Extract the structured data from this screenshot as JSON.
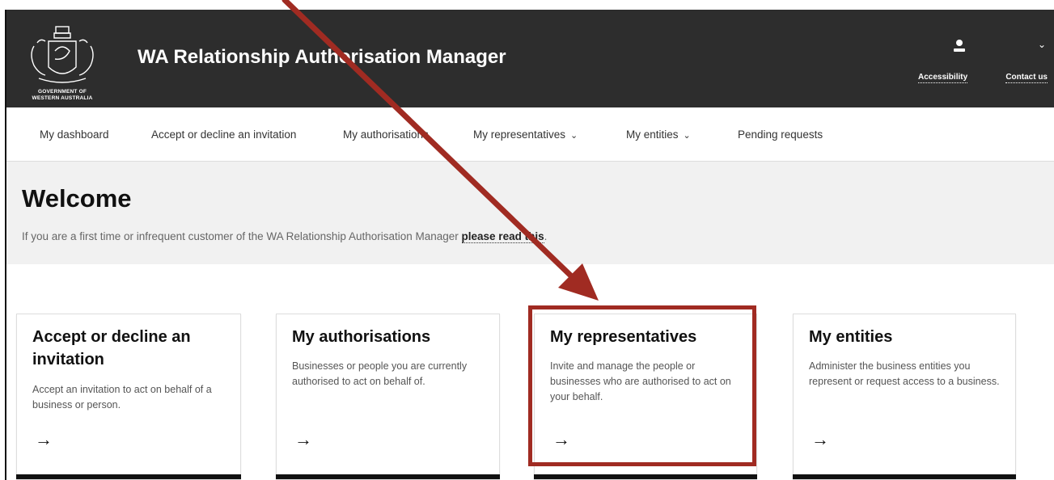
{
  "header": {
    "crest_caption_line1": "GOVERNMENT OF",
    "crest_caption_line2": "WESTERN AUSTRALIA",
    "title": "WA Relationship Authorisation Manager",
    "accessibility_label": "Accessibility",
    "contact_label": "Contact us",
    "user_icon": "user-icon",
    "background_color": "#2d2d2d"
  },
  "nav": {
    "items": [
      {
        "label": "My dashboard"
      },
      {
        "label": "Accept or decline an invitation"
      },
      {
        "label": "My authorisations"
      },
      {
        "label": "My representatives"
      },
      {
        "label": "My entities"
      },
      {
        "label": "Pending requests"
      }
    ]
  },
  "welcome": {
    "heading": "Welcome",
    "intro_text": "If you are a first time or infrequent customer of the WA Relationship Authorisation Manager ",
    "link_text": "please read this",
    "trailing": "."
  },
  "cards": [
    {
      "title": "Accept or decline an invitation",
      "description": "Accept an invitation to act on behalf of a business or person.",
      "arrow": "→"
    },
    {
      "title": "My authorisations",
      "description": "Businesses or people you are currently authorised to act on behalf of.",
      "arrow": "→"
    },
    {
      "title": "My representatives",
      "description": "Invite and manage the people or businesses who are authorised to act on your behalf.",
      "arrow": "→"
    },
    {
      "title": "My entities",
      "description": "Administer the business entities you represent or request access to a business.",
      "arrow": "→"
    }
  ],
  "annotation": {
    "color": "#a02b22",
    "highlighted_card": "My representatives"
  }
}
